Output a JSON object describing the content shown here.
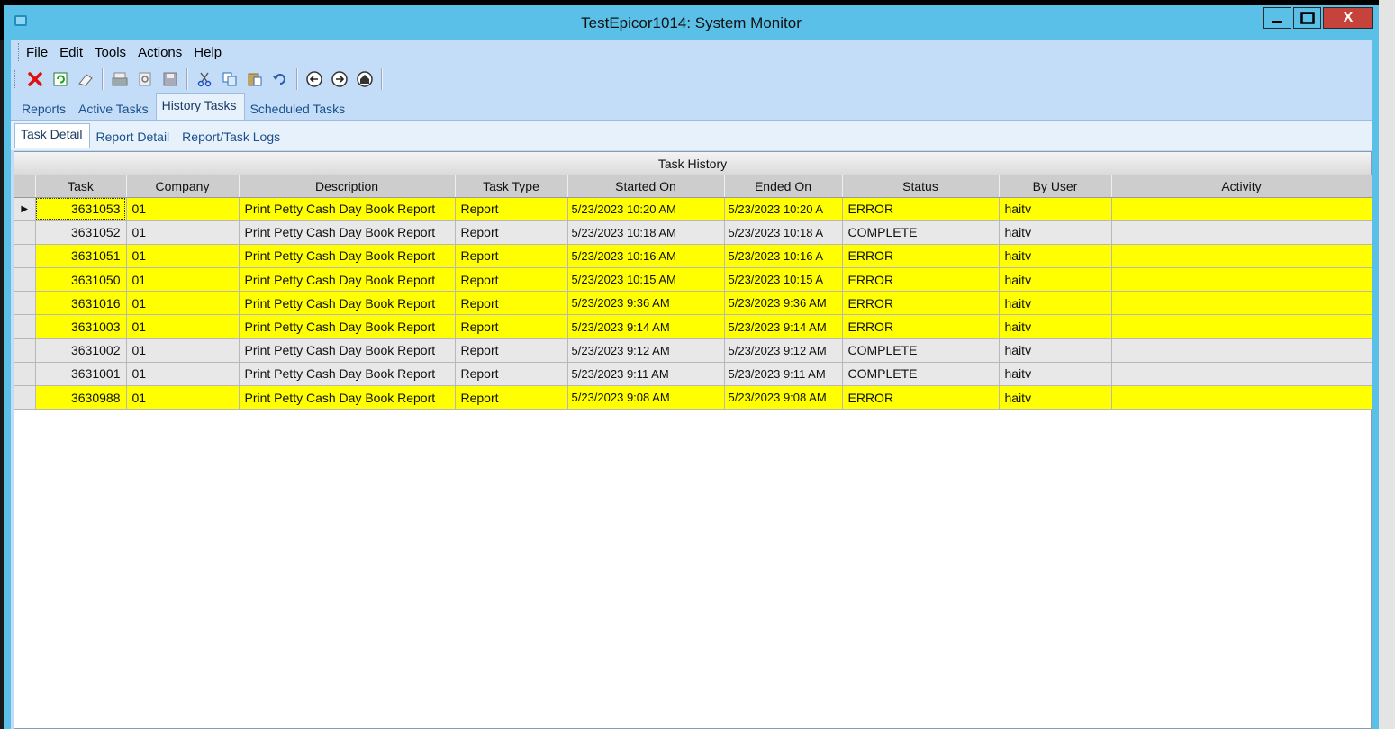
{
  "window": {
    "title": "TestEpicor1014: System Monitor",
    "close_label": "X"
  },
  "menu": [
    "File",
    "Edit",
    "Tools",
    "Actions",
    "Help"
  ],
  "toolbar_icons": [
    "delete-icon",
    "refresh-icon",
    "clear-icon",
    "print-icon",
    "print-preview-icon",
    "save-icon",
    "cut-icon",
    "copy-icon",
    "paste-icon",
    "undo-icon",
    "back-icon",
    "forward-icon",
    "home-icon"
  ],
  "tabs": [
    {
      "label": "Reports",
      "active": false
    },
    {
      "label": "Active Tasks",
      "active": false
    },
    {
      "label": "History Tasks",
      "active": true
    },
    {
      "label": "Scheduled Tasks",
      "active": false
    }
  ],
  "subtabs": [
    {
      "label": "Task Detail",
      "active": true
    },
    {
      "label": "Report Detail",
      "active": false
    },
    {
      "label": "Report/Task Logs",
      "active": false
    }
  ],
  "grid": {
    "caption": "Task History",
    "columns": [
      "Task",
      "Company",
      "Description",
      "Task Type",
      "Started On",
      "Ended On",
      "Status",
      "By User",
      "Activity"
    ],
    "rows": [
      [
        "3631053",
        "01",
        "Print Petty Cash Day Book Report",
        "Report",
        "5/23/2023 10:20 AM",
        "5/23/2023 10:20 A",
        "ERROR",
        "haitv",
        ""
      ],
      [
        "3631052",
        "01",
        "Print Petty Cash Day Book Report",
        "Report",
        "5/23/2023 10:18 AM",
        "5/23/2023 10:18 A",
        "COMPLETE",
        "haitv",
        ""
      ],
      [
        "3631051",
        "01",
        "Print Petty Cash Day Book Report",
        "Report",
        "5/23/2023 10:16 AM",
        "5/23/2023 10:16 A",
        "ERROR",
        "haitv",
        ""
      ],
      [
        "3631050",
        "01",
        "Print Petty Cash Day Book Report",
        "Report",
        "5/23/2023 10:15 AM",
        "5/23/2023 10:15 A",
        "ERROR",
        "haitv",
        ""
      ],
      [
        "3631016",
        "01",
        "Print Petty Cash Day Book Report",
        "Report",
        "5/23/2023 9:36 AM",
        "5/23/2023 9:36 AM",
        "ERROR",
        "haitv",
        ""
      ],
      [
        "3631003",
        "01",
        "Print Petty Cash Day Book Report",
        "Report",
        "5/23/2023 9:14 AM",
        "5/23/2023 9:14 AM",
        "ERROR",
        "haitv",
        ""
      ],
      [
        "3631002",
        "01",
        "Print Petty Cash Day Book Report",
        "Report",
        "5/23/2023 9:12 AM",
        "5/23/2023 9:12 AM",
        "COMPLETE",
        "haitv",
        ""
      ],
      [
        "3631001",
        "01",
        "Print Petty Cash Day Book Report",
        "Report",
        "5/23/2023 9:11 AM",
        "5/23/2023 9:11 AM",
        "COMPLETE",
        "haitv",
        ""
      ],
      [
        "3630988",
        "01",
        "Print Petty Cash Day Book Report",
        "Report",
        "5/23/2023 9:08 AM",
        "5/23/2023 9:08 AM",
        "ERROR",
        "haitv",
        ""
      ]
    ]
  },
  "colors": {
    "error_row": "#ffff00",
    "complete_row": "#e8e8e8",
    "titlebar": "#5bc0e8"
  }
}
